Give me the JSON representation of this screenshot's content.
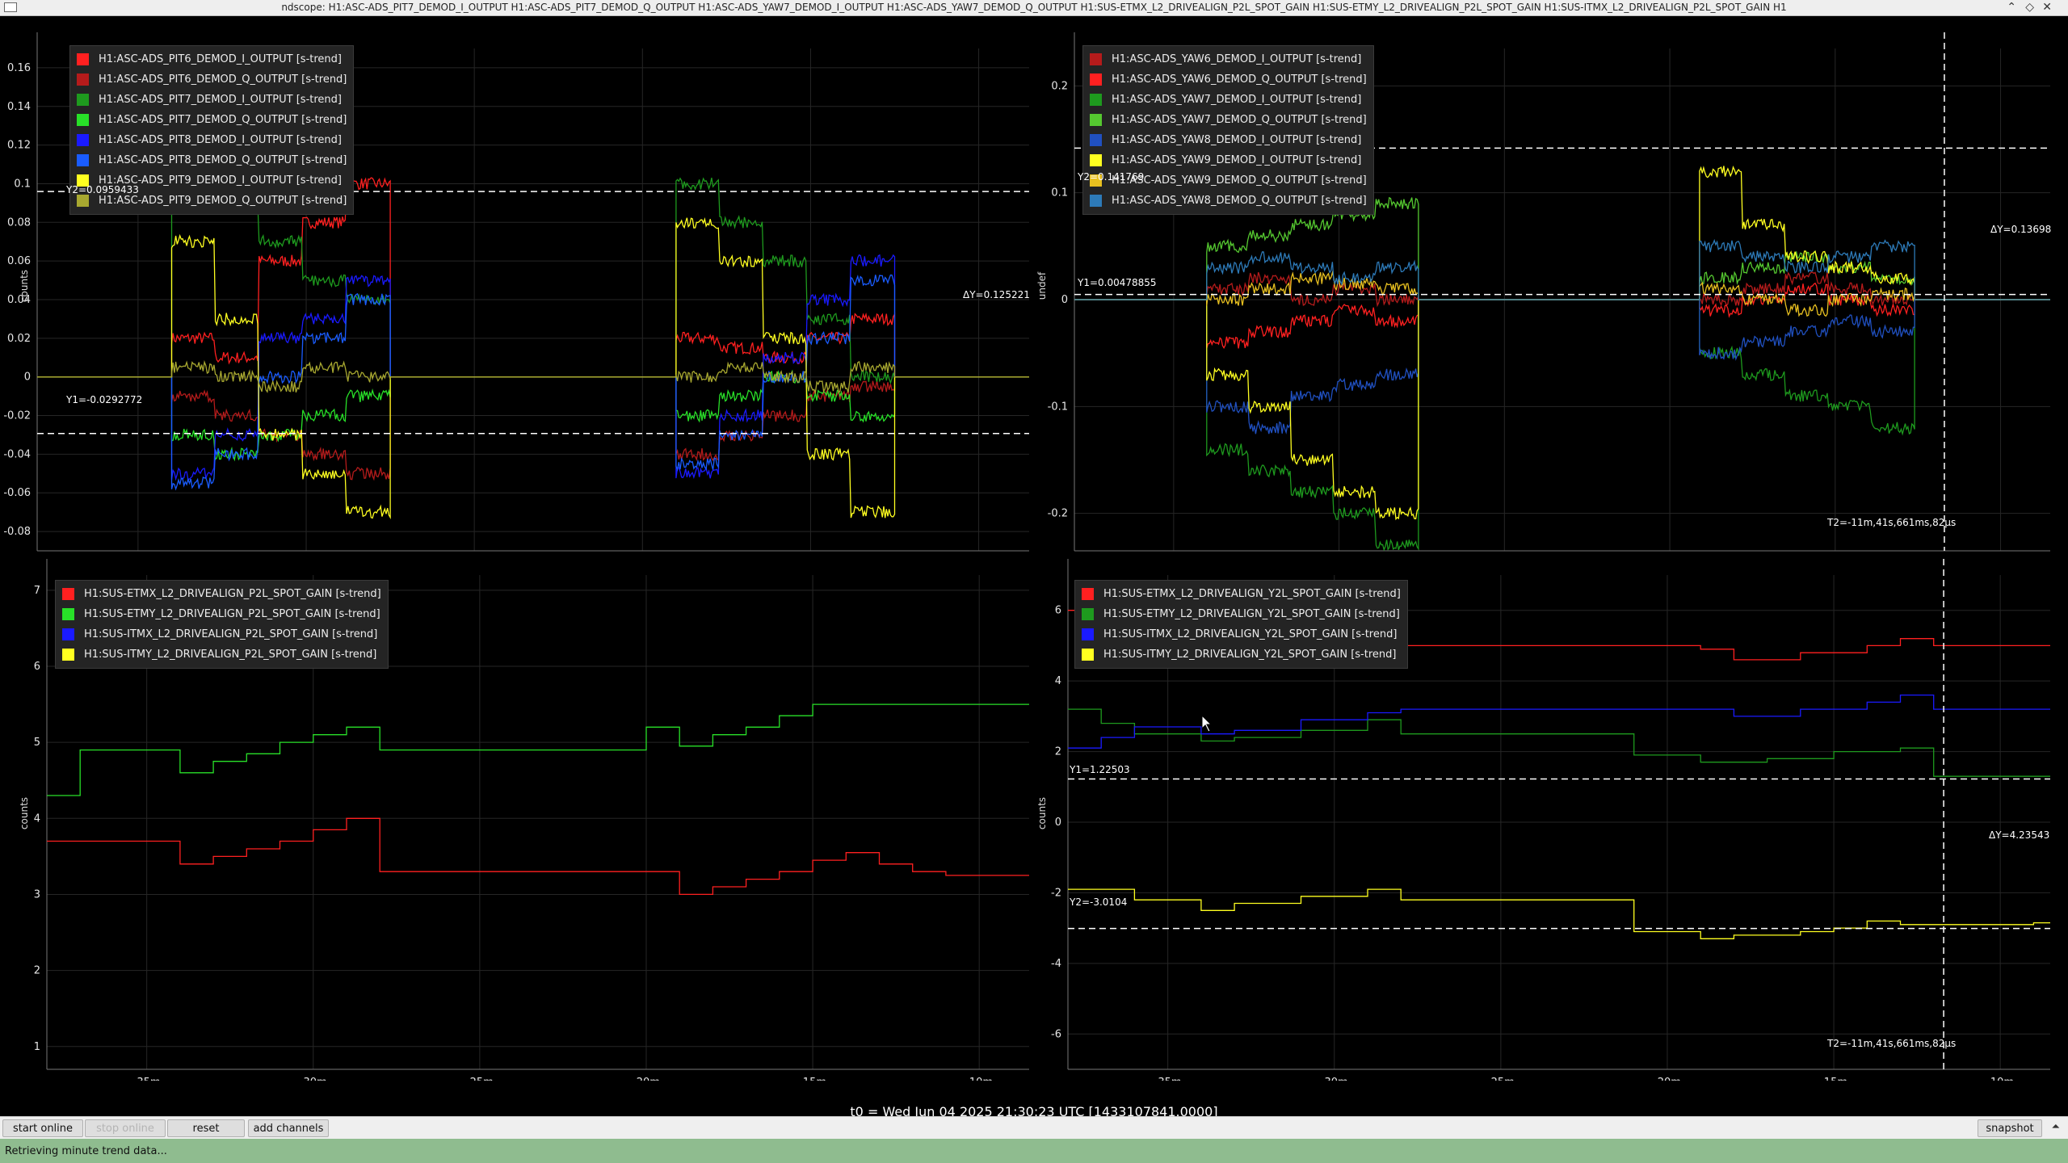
{
  "window": {
    "title": "ndscope: H1:ASC-ADS_PIT7_DEMOD_I_OUTPUT H1:ASC-ADS_PIT7_DEMOD_Q_OUTPUT H1:ASC-ADS_YAW7_DEMOD_I_OUTPUT H1:ASC-ADS_YAW7_DEMOD_Q_OUTPUT H1:SUS-ETMX_L2_DRIVEALIGN_P2L_SPOT_GAIN H1:SUS-ETMY_L2_DRIVEALIGN_P2L_SPOT_GAIN H1:SUS-ITMX_L2_DRIVEALIGN_P2L_SPOT_GAIN H1",
    "controls": {
      "minimize": "⌃",
      "maximize": "◇",
      "close": "✕"
    }
  },
  "plots": [
    {
      "id": "pit",
      "ylabel": "counts",
      "y_ticks": [
        "0.16",
        "0.14",
        "0.12",
        "0.1",
        "0.08",
        "0.06",
        "0.04",
        "0.02",
        "0",
        "-0.02",
        "-0.04",
        "-0.06",
        "-0.08"
      ],
      "x_ticks": [
        "-35m",
        "-30m",
        "-25m",
        "-20m",
        "-15m",
        "-10m"
      ],
      "legend": [
        {
          "label": "H1:ASC-ADS_PIT6_DEMOD_I_OUTPUT [s-trend]",
          "color": "#ff2020"
        },
        {
          "label": "H1:ASC-ADS_PIT6_DEMOD_Q_OUTPUT [s-trend]",
          "color": "#b51b1b"
        },
        {
          "label": "H1:ASC-ADS_PIT7_DEMOD_I_OUTPUT [s-trend]",
          "color": "#1e9a1e"
        },
        {
          "label": "H1:ASC-ADS_PIT7_DEMOD_Q_OUTPUT [s-trend]",
          "color": "#28e028"
        },
        {
          "label": "H1:ASC-ADS_PIT8_DEMOD_I_OUTPUT [s-trend]",
          "color": "#1a1aff"
        },
        {
          "label": "H1:ASC-ADS_PIT8_DEMOD_Q_OUTPUT [s-trend]",
          "color": "#1a5cff"
        },
        {
          "label": "H1:ASC-ADS_PIT9_DEMOD_I_OUTPUT [s-trend]",
          "color": "#ffff20"
        },
        {
          "label": "H1:ASC-ADS_PIT9_DEMOD_Q_OUTPUT [s-trend]",
          "color": "#a8a830"
        }
      ],
      "cursor_y1": "Y1=-0.0292772",
      "cursor_y2": "Y2=0.0959433",
      "cursor_dy": "ΔY=0.125221",
      "cursor_t2": ""
    },
    {
      "id": "yaw",
      "ylabel": "undef",
      "y_ticks": [
        "0.2",
        "0.1",
        "0",
        "-0.1",
        "-0.2"
      ],
      "x_ticks": [
        "-35m",
        "-30m",
        "-25m",
        "-20m",
        "-15m",
        "-10m"
      ],
      "legend": [
        {
          "label": "H1:ASC-ADS_YAW6_DEMOD_I_OUTPUT [s-trend]",
          "color": "#b51b1b"
        },
        {
          "label": "H1:ASC-ADS_YAW6_DEMOD_Q_OUTPUT [s-trend]",
          "color": "#ff2020"
        },
        {
          "label": "H1:ASC-ADS_YAW7_DEMOD_I_OUTPUT [s-trend]",
          "color": "#1e9a1e"
        },
        {
          "label": "H1:ASC-ADS_YAW7_DEMOD_Q_OUTPUT [s-trend]",
          "color": "#55c830"
        },
        {
          "label": "H1:ASC-ADS_YAW8_DEMOD_I_OUTPUT [s-trend]",
          "color": "#2050c0"
        },
        {
          "label": "H1:ASC-ADS_YAW9_DEMOD_I_OUTPUT [s-trend]",
          "color": "#ffff20"
        },
        {
          "label": "H1:ASC-ADS_YAW9_DEMOD_Q_OUTPUT [s-trend]",
          "color": "#e8c020"
        },
        {
          "label": "H1:ASC-ADS_YAW8_DEMOD_Q_OUTPUT [s-trend]",
          "color": "#2d7ab8"
        }
      ],
      "cursor_y1": "Y1=0.00478855",
      "cursor_y2": "Y2=0.141769",
      "cursor_dy": "ΔY=0.13698",
      "cursor_t2": "T2=-11m,41s,661ms,82μs"
    },
    {
      "id": "p2l",
      "ylabel": "counts",
      "y_ticks": [
        "7",
        "6",
        "5",
        "4",
        "3",
        "2",
        "1"
      ],
      "x_ticks": [
        "-35m",
        "-30m",
        "-25m",
        "-20m",
        "-15m",
        "-10m"
      ],
      "legend": [
        {
          "label": "H1:SUS-ETMX_L2_DRIVEALIGN_P2L_SPOT_GAIN [s-trend]",
          "color": "#ff2020"
        },
        {
          "label": "H1:SUS-ETMY_L2_DRIVEALIGN_P2L_SPOT_GAIN [s-trend]",
          "color": "#28e028"
        },
        {
          "label": "H1:SUS-ITMX_L2_DRIVEALIGN_P2L_SPOT_GAIN [s-trend]",
          "color": "#1a1aff"
        },
        {
          "label": "H1:SUS-ITMY_L2_DRIVEALIGN_P2L_SPOT_GAIN [s-trend]",
          "color": "#ffff20"
        }
      ],
      "cursor_y1": "",
      "cursor_y2": "",
      "cursor_dy": "",
      "cursor_t2": ""
    },
    {
      "id": "y2l",
      "ylabel": "counts",
      "y_ticks": [
        "6",
        "4",
        "2",
        "0",
        "-2",
        "-4",
        "-6"
      ],
      "x_ticks": [
        "-35m",
        "-30m",
        "-25m",
        "-20m",
        "-15m",
        "-10m"
      ],
      "legend": [
        {
          "label": "H1:SUS-ETMX_L2_DRIVEALIGN_Y2L_SPOT_GAIN [s-trend]",
          "color": "#ff2020"
        },
        {
          "label": "H1:SUS-ETMY_L2_DRIVEALIGN_Y2L_SPOT_GAIN [s-trend]",
          "color": "#1e9a1e"
        },
        {
          "label": "H1:SUS-ITMX_L2_DRIVEALIGN_Y2L_SPOT_GAIN [s-trend]",
          "color": "#1a1aff"
        },
        {
          "label": "H1:SUS-ITMY_L2_DRIVEALIGN_Y2L_SPOT_GAIN [s-trend]",
          "color": "#ffff20"
        }
      ],
      "cursor_y1": "Y1=1.22503",
      "cursor_y2": "Y2=-3.0104",
      "cursor_dy": "ΔY=4.23543",
      "cursor_t2": "T2=-11m,41s,661ms,82μs"
    }
  ],
  "chart_data": [
    {
      "type": "line",
      "xlabel": "",
      "ylabel": "counts",
      "xlim": [
        -38,
        -8.5
      ],
      "ylim": [
        -0.09,
        0.17
      ],
      "cursors": {
        "y1": -0.0292772,
        "y2": 0.0959433
      },
      "segments": [
        [
          -34,
          -27.5
        ],
        [
          -19,
          -12.5
        ]
      ],
      "series": [
        {
          "name": "H1:ASC-ADS_PIT6_DEMOD_I_OUTPUT [s-trend]",
          "levels": [
            [
              0.02,
              0.01,
              0.06,
              0.08,
              0.1
            ],
            [
              0.02,
              0.015,
              0.01,
              0.02,
              0.03
            ]
          ]
        },
        {
          "name": "H1:ASC-ADS_PIT6_DEMOD_Q_OUTPUT [s-trend]",
          "levels": [
            [
              -0.01,
              -0.02,
              -0.03,
              -0.04,
              -0.05
            ],
            [
              -0.04,
              -0.03,
              -0.02,
              -0.01,
              -0.005
            ]
          ]
        },
        {
          "name": "H1:ASC-ADS_PIT7_DEMOD_I_OUTPUT [s-trend]",
          "levels": [
            [
              0.12,
              0.09,
              0.07,
              0.05,
              0.04
            ],
            [
              0.1,
              0.08,
              0.06,
              0.03,
              0.0
            ]
          ]
        },
        {
          "name": "H1:ASC-ADS_PIT7_DEMOD_Q_OUTPUT [s-trend]",
          "levels": [
            [
              -0.03,
              -0.04,
              -0.03,
              -0.02,
              -0.01
            ],
            [
              -0.02,
              -0.01,
              0.0,
              -0.01,
              -0.02
            ]
          ]
        },
        {
          "name": "H1:ASC-ADS_PIT8_DEMOD_I_OUTPUT [s-trend]",
          "levels": [
            [
              -0.05,
              -0.03,
              0.02,
              0.03,
              0.05
            ],
            [
              -0.05,
              -0.02,
              0.01,
              0.04,
              0.06
            ]
          ]
        },
        {
          "name": "H1:ASC-ADS_PIT8_DEMOD_Q_OUTPUT [s-trend]",
          "levels": [
            [
              -0.055,
              -0.04,
              0.0,
              0.02,
              0.04
            ],
            [
              -0.045,
              -0.03,
              0.0,
              0.02,
              0.05
            ]
          ]
        },
        {
          "name": "H1:ASC-ADS_PIT9_DEMOD_I_OUTPUT [s-trend]",
          "levels": [
            [
              0.07,
              0.03,
              -0.03,
              -0.05,
              -0.07
            ],
            [
              0.08,
              0.06,
              0.02,
              -0.04,
              -0.07
            ]
          ]
        },
        {
          "name": "H1:ASC-ADS_PIT9_DEMOD_Q_OUTPUT [s-trend]",
          "levels": [
            [
              0.005,
              0.0,
              -0.005,
              0.005,
              0.0
            ],
            [
              0.0,
              0.005,
              0.0,
              -0.005,
              0.005
            ]
          ]
        }
      ]
    },
    {
      "type": "line",
      "xlabel": "",
      "ylabel": "undef",
      "xlim": [
        -38,
        -8.5
      ],
      "ylim": [
        -0.235,
        0.235
      ],
      "cursors": {
        "y1": 0.00478855,
        "y2": 0.141769,
        "t2": -11.7
      },
      "segments": [
        [
          -34,
          -27.6
        ],
        [
          -19.1,
          -12.6
        ]
      ],
      "series": [
        {
          "name": "H1:ASC-ADS_YAW6_DEMOD_I_OUTPUT [s-trend]",
          "levels": [
            [
              0.01,
              0.02,
              0.0,
              0.01,
              0.0
            ],
            [
              0.0,
              0.01,
              0.02,
              0.01,
              0.0
            ]
          ]
        },
        {
          "name": "H1:ASC-ADS_YAW6_DEMOD_Q_OUTPUT [s-trend]",
          "levels": [
            [
              -0.04,
              -0.03,
              -0.02,
              -0.01,
              -0.02
            ],
            [
              -0.01,
              0.0,
              0.01,
              0.0,
              -0.01
            ]
          ]
        },
        {
          "name": "H1:ASC-ADS_YAW7_DEMOD_I_OUTPUT [s-trend]",
          "levels": [
            [
              -0.14,
              -0.16,
              -0.18,
              -0.2,
              -0.23
            ],
            [
              -0.05,
              -0.07,
              -0.09,
              -0.1,
              -0.12
            ]
          ]
        },
        {
          "name": "H1:ASC-ADS_YAW7_DEMOD_Q_OUTPUT [s-trend]",
          "levels": [
            [
              0.05,
              0.06,
              0.07,
              0.08,
              0.09
            ],
            [
              0.02,
              0.03,
              0.04,
              0.03,
              0.02
            ]
          ]
        },
        {
          "name": "H1:ASC-ADS_YAW8_DEMOD_I_OUTPUT [s-trend]",
          "levels": [
            [
              -0.1,
              -0.12,
              -0.09,
              -0.08,
              -0.07
            ],
            [
              -0.05,
              -0.04,
              -0.03,
              -0.02,
              -0.03
            ]
          ]
        },
        {
          "name": "H1:ASC-ADS_YAW9_DEMOD_I_OUTPUT [s-trend]",
          "levels": [
            [
              -0.07,
              -0.1,
              -0.15,
              -0.18,
              -0.2
            ],
            [
              0.12,
              0.07,
              0.04,
              0.03,
              0.02
            ]
          ]
        },
        {
          "name": "H1:ASC-ADS_YAW9_DEMOD_Q_OUTPUT [s-trend]",
          "levels": [
            [
              0.0,
              0.01,
              0.02,
              0.015,
              0.01
            ],
            [
              0.01,
              0.0,
              -0.01,
              0.0,
              0.005
            ]
          ]
        },
        {
          "name": "H1:ASC-ADS_YAW8_DEMOD_Q_OUTPUT [s-trend]",
          "levels": [
            [
              0.03,
              0.04,
              0.03,
              0.02,
              0.03
            ],
            [
              0.05,
              0.04,
              0.03,
              0.04,
              0.05
            ]
          ]
        }
      ]
    },
    {
      "type": "line",
      "xlabel": "",
      "ylabel": "counts",
      "xlim": [
        -38,
        -8.5
      ],
      "ylim": [
        0.7,
        7.2
      ],
      "series": [
        {
          "name": "H1:SUS-ETMX_L2_DRIVEALIGN_P2L_SPOT_GAIN [s-trend]",
          "steps": [
            [
              -38,
              3.7
            ],
            [
              -34,
              3.4
            ],
            [
              -33,
              3.5
            ],
            [
              -32,
              3.6
            ],
            [
              -31,
              3.7
            ],
            [
              -30,
              3.85
            ],
            [
              -29,
              4.0
            ],
            [
              -28,
              3.3
            ],
            [
              -19,
              3.0
            ],
            [
              -18,
              3.1
            ],
            [
              -17,
              3.2
            ],
            [
              -16,
              3.3
            ],
            [
              -15,
              3.45
            ],
            [
              -14,
              3.55
            ],
            [
              -13,
              3.4
            ],
            [
              -12,
              3.3
            ],
            [
              -11,
              3.25
            ]
          ]
        },
        {
          "name": "H1:SUS-ETMY_L2_DRIVEALIGN_P2L_SPOT_GAIN [s-trend]",
          "steps": [
            [
              -38,
              4.3
            ],
            [
              -37,
              4.9
            ],
            [
              -34,
              4.6
            ],
            [
              -33,
              4.75
            ],
            [
              -32,
              4.85
            ],
            [
              -31,
              5.0
            ],
            [
              -30,
              5.1
            ],
            [
              -29,
              5.2
            ],
            [
              -28,
              4.9
            ],
            [
              -20,
              5.2
            ],
            [
              -19,
              4.95
            ],
            [
              -18,
              5.1
            ],
            [
              -17,
              5.2
            ],
            [
              -16,
              5.35
            ],
            [
              -15,
              5.5
            ],
            [
              -9,
              5.5
            ]
          ]
        },
        {
          "name": "H1:SUS-ITMX_L2_DRIVEALIGN_P2L_SPOT_GAIN [s-trend]",
          "steps": []
        },
        {
          "name": "H1:SUS-ITMY_L2_DRIVEALIGN_P2L_SPOT_GAIN [s-trend]",
          "steps": []
        }
      ]
    },
    {
      "type": "line",
      "xlabel": "",
      "ylabel": "counts",
      "xlim": [
        -38,
        -8.5
      ],
      "ylim": [
        -7,
        7
      ],
      "cursors": {
        "y1": 1.22503,
        "y2": -3.0104,
        "t2": -11.7
      },
      "series": [
        {
          "name": "H1:SUS-ETMX_L2_DRIVEALIGN_Y2L_SPOT_GAIN [s-trend]",
          "steps": [
            [
              -38,
              6.0
            ],
            [
              -36,
              5.5
            ],
            [
              -32,
              5.2
            ],
            [
              -29,
              5.3
            ],
            [
              -28,
              5.0
            ],
            [
              -19,
              4.9
            ],
            [
              -18,
              4.6
            ],
            [
              -16,
              4.8
            ],
            [
              -14,
              5.0
            ],
            [
              -13,
              5.2
            ],
            [
              -12,
              5.0
            ],
            [
              -9,
              5.0
            ]
          ]
        },
        {
          "name": "H1:SUS-ETMY_L2_DRIVEALIGN_Y2L_SPOT_GAIN [s-trend]",
          "steps": [
            [
              -38,
              3.2
            ],
            [
              -37,
              2.8
            ],
            [
              -36,
              2.5
            ],
            [
              -34,
              2.3
            ],
            [
              -33,
              2.4
            ],
            [
              -31,
              2.6
            ],
            [
              -29,
              2.9
            ],
            [
              -28,
              2.5
            ],
            [
              -21,
              1.9
            ],
            [
              -19,
              1.7
            ],
            [
              -17,
              1.8
            ],
            [
              -15,
              2.0
            ],
            [
              -13,
              2.1
            ],
            [
              -12,
              1.3
            ],
            [
              -9,
              1.3
            ]
          ]
        },
        {
          "name": "H1:SUS-ITMX_L2_DRIVEALIGN_Y2L_SPOT_GAIN [s-trend]",
          "steps": [
            [
              -38,
              2.1
            ],
            [
              -37,
              2.4
            ],
            [
              -36,
              2.7
            ],
            [
              -34,
              2.5
            ],
            [
              -33,
              2.6
            ],
            [
              -31,
              2.9
            ],
            [
              -29,
              3.1
            ],
            [
              -28,
              3.2
            ],
            [
              -18,
              3.0
            ],
            [
              -16,
              3.2
            ],
            [
              -14,
              3.4
            ],
            [
              -13,
              3.6
            ],
            [
              -12,
              3.2
            ],
            [
              -9,
              3.2
            ]
          ]
        },
        {
          "name": "H1:SUS-ITMY_L2_DRIVEALIGN_Y2L_SPOT_GAIN [s-trend]",
          "steps": [
            [
              -38,
              -1.9
            ],
            [
              -36,
              -2.2
            ],
            [
              -34,
              -2.5
            ],
            [
              -33,
              -2.3
            ],
            [
              -31,
              -2.1
            ],
            [
              -29,
              -1.9
            ],
            [
              -28,
              -2.2
            ],
            [
              -21,
              -3.1
            ],
            [
              -19,
              -3.3
            ],
            [
              -18,
              -3.2
            ],
            [
              -16,
              -3.1
            ],
            [
              -15,
              -3.0
            ],
            [
              -14,
              -2.8
            ],
            [
              -13,
              -2.9
            ],
            [
              -9,
              -2.85
            ]
          ]
        }
      ]
    }
  ],
  "t0_label": "t0 = Wed Jun 04 2025 21:30:23 UTC [1433107841.0000]",
  "toolbar": {
    "start_online": "start online",
    "stop_online": "stop online",
    "reset": "reset",
    "add_channels": "add channels",
    "snapshot": "snapshot",
    "arrow": "⏶"
  },
  "status": "Retrieving minute trend data...",
  "colors": {
    "background": "#000000",
    "grid": "#262626",
    "axis": "#777777",
    "cursor": "#ffffff",
    "status_bg": "#8fbc8f"
  }
}
